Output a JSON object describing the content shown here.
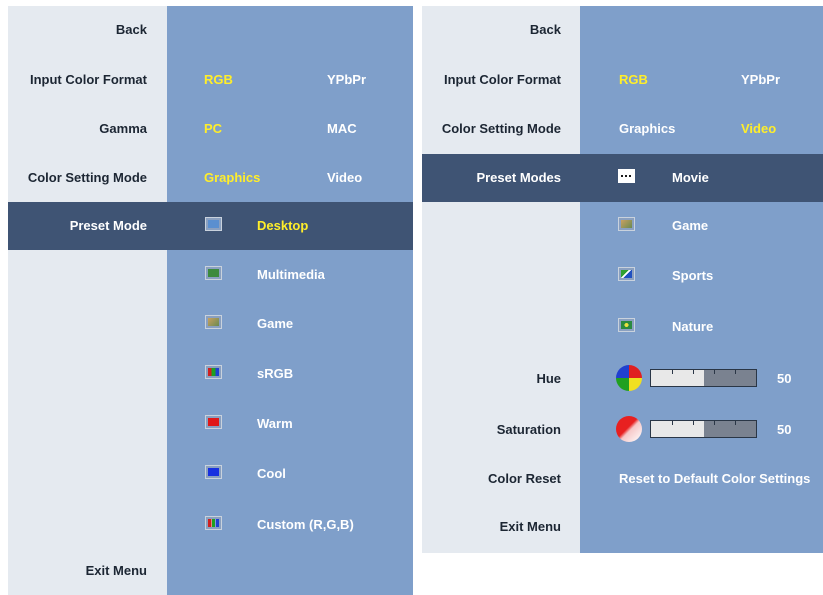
{
  "left_panel": {
    "labels": {
      "back": "Back",
      "input_color_format": "Input Color Format",
      "gamma": "Gamma",
      "color_setting_mode": "Color Setting Mode",
      "preset_mode": "Preset Mode",
      "exit_menu": "Exit Menu"
    },
    "input_color_format": {
      "opt1": "RGB",
      "opt2": "YPbPr",
      "selected": "RGB"
    },
    "gamma": {
      "opt1": "PC",
      "opt2": "MAC",
      "selected": "PC"
    },
    "color_setting_mode": {
      "opt1": "Graphics",
      "opt2": "Video",
      "selected": "Graphics"
    },
    "presets": [
      {
        "label": "Desktop",
        "icon": "desktop-icon",
        "selected": true
      },
      {
        "label": "Multimedia",
        "icon": "multimedia-icon"
      },
      {
        "label": "Game",
        "icon": "game-icon"
      },
      {
        "label": "sRGB",
        "icon": "srgb-icon"
      },
      {
        "label": "Warm",
        "icon": "warm-icon"
      },
      {
        "label": "Cool",
        "icon": "cool-icon"
      },
      {
        "label": "Custom (R,G,B)",
        "icon": "custom-rgb-icon"
      }
    ]
  },
  "right_panel": {
    "labels": {
      "back": "Back",
      "input_color_format": "Input Color Format",
      "color_setting_mode": "Color Setting Mode",
      "preset_modes": "Preset Modes",
      "hue": "Hue",
      "saturation": "Saturation",
      "color_reset": "Color Reset",
      "exit_menu": "Exit Menu"
    },
    "input_color_format": {
      "opt1": "RGB",
      "opt2": "YPbPr",
      "selected": "RGB"
    },
    "color_setting_mode": {
      "opt1": "Graphics",
      "opt2": "Video",
      "selected": "Video"
    },
    "presets": [
      {
        "label": "Movie",
        "icon": "movie-icon",
        "selected": true
      },
      {
        "label": "Game",
        "icon": "game-icon"
      },
      {
        "label": "Sports",
        "icon": "sports-icon"
      },
      {
        "label": "Nature",
        "icon": "nature-icon"
      }
    ],
    "hue": {
      "value": "50",
      "level": 0.5
    },
    "saturation": {
      "value": "50",
      "level": 0.5
    },
    "color_reset": "Reset to Default Color Settings"
  },
  "colors": {
    "label_column": "#e5eaf0",
    "value_column": "#7f9fca",
    "highlight_row": "#3f5474",
    "selected_option": "#ffee2a",
    "text_white": "#ffffff",
    "text_dark": "#1c2633"
  }
}
